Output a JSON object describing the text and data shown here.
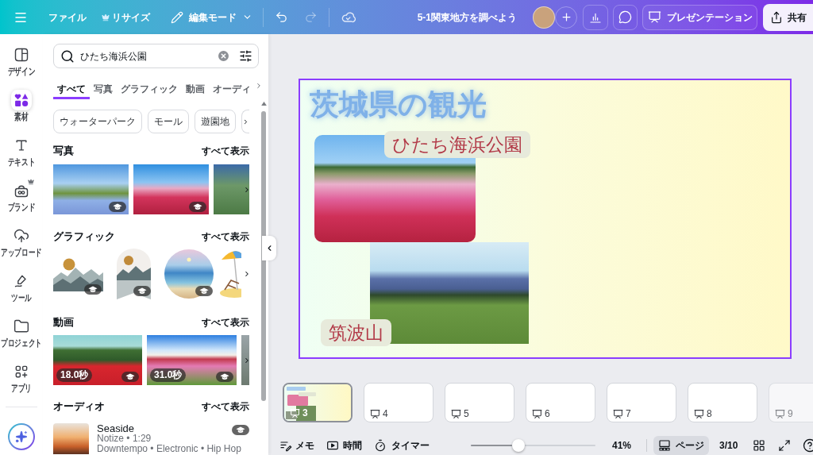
{
  "top_bar": {
    "file_menu": "ファイル",
    "resize": {
      "label": "リサイズ",
      "premium": true
    },
    "edit_mode": "編集モード",
    "undo": {
      "disabled": false
    },
    "redo": {
      "disabled": true
    },
    "document_title": "5-1関東地方を調べよう",
    "present_button": "プレゼンテーション",
    "share_button": "共有"
  },
  "sidebar": {
    "items": [
      {
        "label": "デザイン",
        "selected": false,
        "premium": false
      },
      {
        "label": "素材",
        "selected": true,
        "premium": false
      },
      {
        "label": "テキスト",
        "selected": false,
        "premium": false
      },
      {
        "label": "ブランド",
        "selected": false,
        "premium": true
      },
      {
        "label": "アップロード",
        "selected": false,
        "premium": false
      },
      {
        "label": "ツール",
        "selected": false,
        "premium": false
      },
      {
        "label": "プロジェクト",
        "selected": false,
        "premium": false
      },
      {
        "label": "アプリ",
        "selected": false,
        "premium": false
      }
    ]
  },
  "panel": {
    "search": {
      "value": "ひたち海浜公園"
    },
    "tabs": [
      {
        "label": "すべて",
        "selected": true
      },
      {
        "label": "写真",
        "selected": false
      },
      {
        "label": "グラフィック",
        "selected": false
      },
      {
        "label": "動画",
        "selected": false
      },
      {
        "label": "オーディ",
        "selected": false
      }
    ],
    "chips": [
      "ウォーターパーク",
      "モール",
      "遊園地"
    ],
    "sections": [
      {
        "kind": "photos",
        "title": "写真",
        "see_all": "すべて表示",
        "items": [
          {
            "badge": true
          },
          {
            "badge": true
          },
          {
            "badge": false
          }
        ]
      },
      {
        "kind": "graphics",
        "title": "グラフィック",
        "see_all": "すべて表示",
        "items": [
          {
            "badge": true
          },
          {
            "badge": true
          },
          {
            "badge": true
          },
          {
            "badge": false
          }
        ]
      },
      {
        "kind": "videos",
        "title": "動画",
        "see_all": "すべて表示",
        "items": [
          {
            "duration": "18.0秒",
            "badge": true
          },
          {
            "duration": "31.0秒",
            "badge": true
          },
          {
            "badge": false
          }
        ]
      },
      {
        "kind": "audio",
        "title": "オーディオ",
        "see_all": "すべて表示",
        "items": [
          {
            "title": "Seaside",
            "meta": "Notize • 1:29",
            "genres": "Downtempo • Electronic • Hip Hop",
            "badge": true
          }
        ]
      }
    ]
  },
  "slide": {
    "title": "茨城県の観光",
    "photos": [
      {
        "caption": "ひたち海浜公園"
      },
      {
        "caption": "筑波山"
      }
    ]
  },
  "pages": [
    {
      "number": "3",
      "selected": true
    },
    {
      "number": "4",
      "selected": false
    },
    {
      "number": "5",
      "selected": false
    },
    {
      "number": "6",
      "selected": false
    },
    {
      "number": "7",
      "selected": false
    },
    {
      "number": "8",
      "selected": false
    },
    {
      "number": "9",
      "selected": false
    }
  ],
  "bottom_bar": {
    "notes": "メモ",
    "duration": "時間",
    "timer": "タイマー",
    "zoom": {
      "level": 0.38,
      "reading": "41%"
    },
    "page_view": {
      "label": "ページ",
      "selected": true
    },
    "page_count": "3/10"
  }
}
